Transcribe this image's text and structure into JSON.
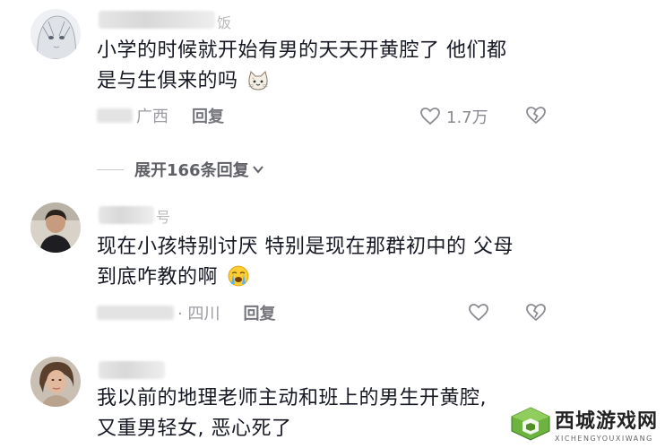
{
  "comments": [
    {
      "name_suffix": "饭",
      "text_line1": "小学的时候就开始有男的天天开黄腔了 他们都",
      "text_line2": "是与生俱来的吗",
      "emoji": "cat-face-emoji",
      "location": "广西",
      "reply_label": "回复",
      "like_count": "1.7万"
    },
    {
      "name_suffix": "号",
      "text_line1": "现在小孩特别讨厌 特别是现在那群初中的 父母",
      "text_line2": "到底咋教的啊",
      "emoji": "crying-face-emoji",
      "location": "· 四川",
      "reply_label": "回复",
      "like_count": ""
    },
    {
      "name_suffix": "",
      "text_line1": "我以前的地理老师主动和班上的男生开黄腔,",
      "text_line2": "又重男轻女, 恶心死了"
    }
  ],
  "expand_replies": "展开166条回复",
  "watermark": {
    "title": "西城游戏网",
    "subtitle": "XICHENGYOUXIWANG"
  },
  "colors": {
    "text": "#161823",
    "meta": "#8a8b91",
    "watermark_green": "#5aa02c"
  }
}
